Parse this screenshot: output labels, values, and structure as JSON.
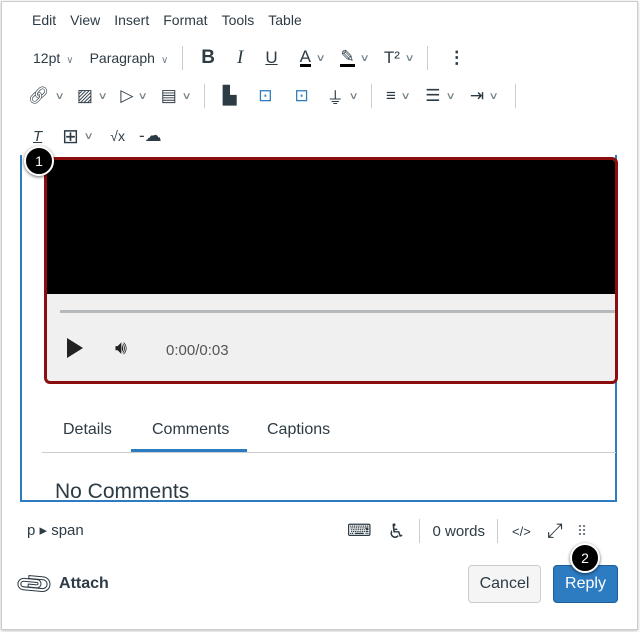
{
  "menubar": [
    "Edit",
    "View",
    "Insert",
    "Format",
    "Tools",
    "Table"
  ],
  "toolbar": {
    "font_size": "12pt",
    "block_format": "Paragraph"
  },
  "media": {
    "time": "0:00/0:03"
  },
  "media_tabs": [
    "Details",
    "Comments",
    "Captions"
  ],
  "active_tab": "Comments",
  "comments_heading": "No Comments",
  "status": {
    "path": "p ▸ span",
    "word_count": "0 words",
    "html_toggle": "</>"
  },
  "footer": {
    "attach": "Attach",
    "cancel": "Cancel",
    "reply": "Reply"
  },
  "callouts": [
    "1",
    "2"
  ],
  "colors": {
    "accent": "#2d7bc0",
    "video_border": "#8b0d0d"
  }
}
